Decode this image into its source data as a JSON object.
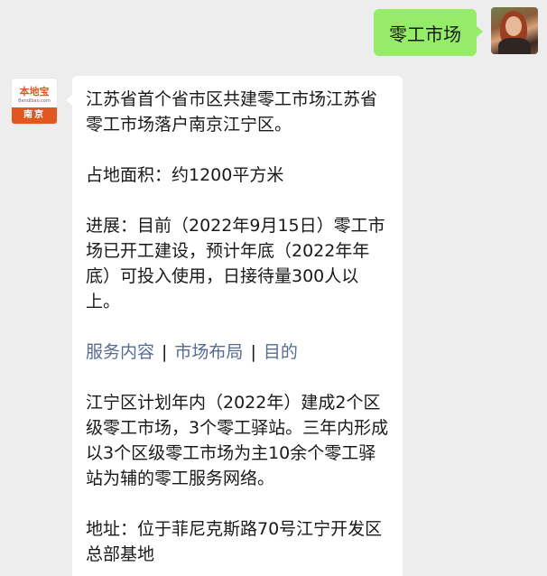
{
  "outgoing": {
    "text": "零工市场"
  },
  "bot": {
    "brand": "本地宝",
    "domain": "Bendibao.com",
    "city": "南京"
  },
  "message": {
    "intro": "江苏省首个省市区共建零工市场江苏省零工市场落户南京江宁区。",
    "area": "占地面积：约1200平方米",
    "progress": "进展：目前（2022年9月15日）零工市场已开工建设，预计年底（2022年年底）可投入使用，日接待量300人以上。",
    "links": [
      {
        "label": "服务内容"
      },
      {
        "label": "市场布局"
      },
      {
        "label": "目的"
      }
    ],
    "link_separator": "|",
    "plan": "江宁区计划年内（2022年）建成2个区级零工市场，3个零工驿站。三年内形成以3个区级零工市场为主10余个零工驿站为辅的零工服务网络。",
    "address": "地址：位于菲尼克斯路70号江宁开发区总部基地"
  },
  "colors": {
    "background": "#ededed",
    "outgoing_bubble": "#95ec69",
    "incoming_bubble": "#ffffff",
    "link": "#576b95",
    "brand_orange": "#e0581f"
  }
}
